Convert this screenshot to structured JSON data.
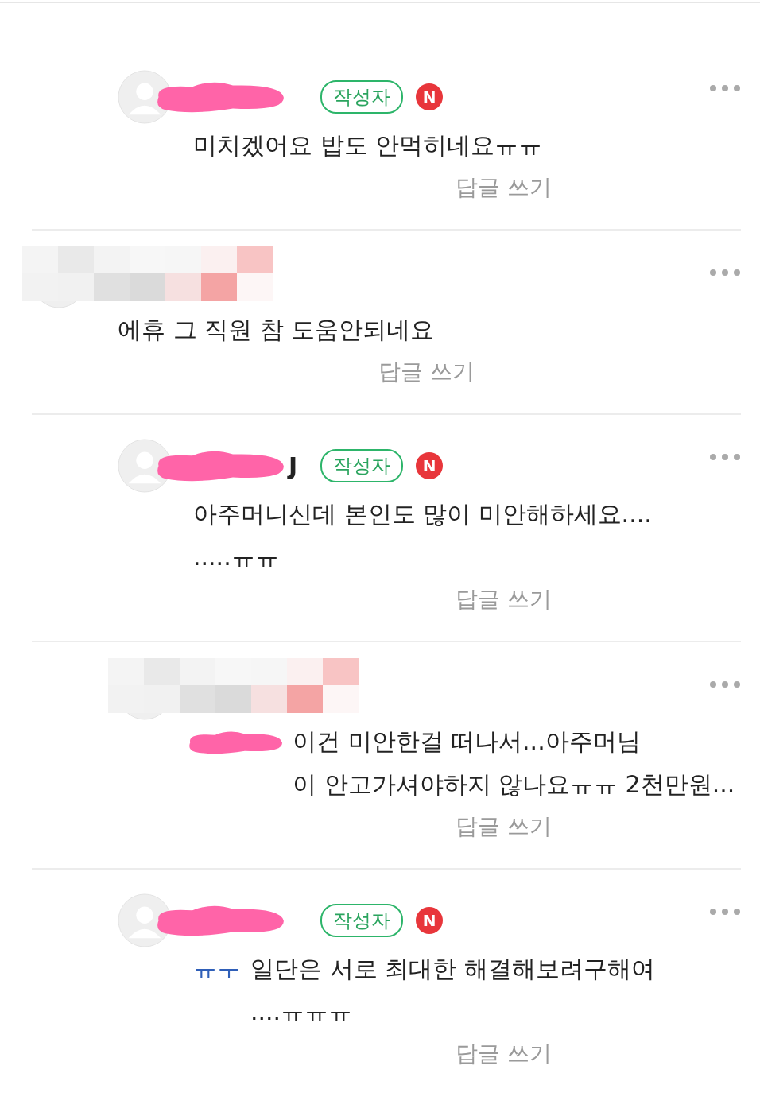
{
  "comments": [
    {
      "kind": "reply",
      "pixelated": false,
      "author_badge": "작성자",
      "new_badge": "N",
      "text": "미치겠어요 밥도 안먹히네요ㅠㅠ",
      "reply_link": "답글 쓰기"
    },
    {
      "kind": "comment",
      "pixelated": true,
      "text": "에휴 그 직원 참 도움안되네요",
      "reply_link": "답글 쓰기",
      "children": [
        {
          "kind": "reply",
          "pixelated": false,
          "name": "J",
          "author_badge": "작성자",
          "new_badge": "N",
          "text": "아주머니신데 본인도 많이 미안해하세요....\n.....ㅠㅠ",
          "reply_link": "답글 쓰기"
        },
        {
          "kind": "reply",
          "pixelated": true,
          "mention_redacted": true,
          "text": "이건 미안한걸 떠나서...아주머님\n이 안고가셔야하지 않나요ㅠㅠ 2천만원...",
          "reply_link": "답글 쓰기"
        },
        {
          "kind": "reply",
          "pixelated": false,
          "author_badge": "작성자",
          "new_badge": "N",
          "mention": "ㅠㅜ",
          "text": "일단은 서로 최대한 해결해보려구해여\n....ㅠㅠㅠ",
          "reply_link": "답글 쓰기"
        }
      ]
    }
  ]
}
